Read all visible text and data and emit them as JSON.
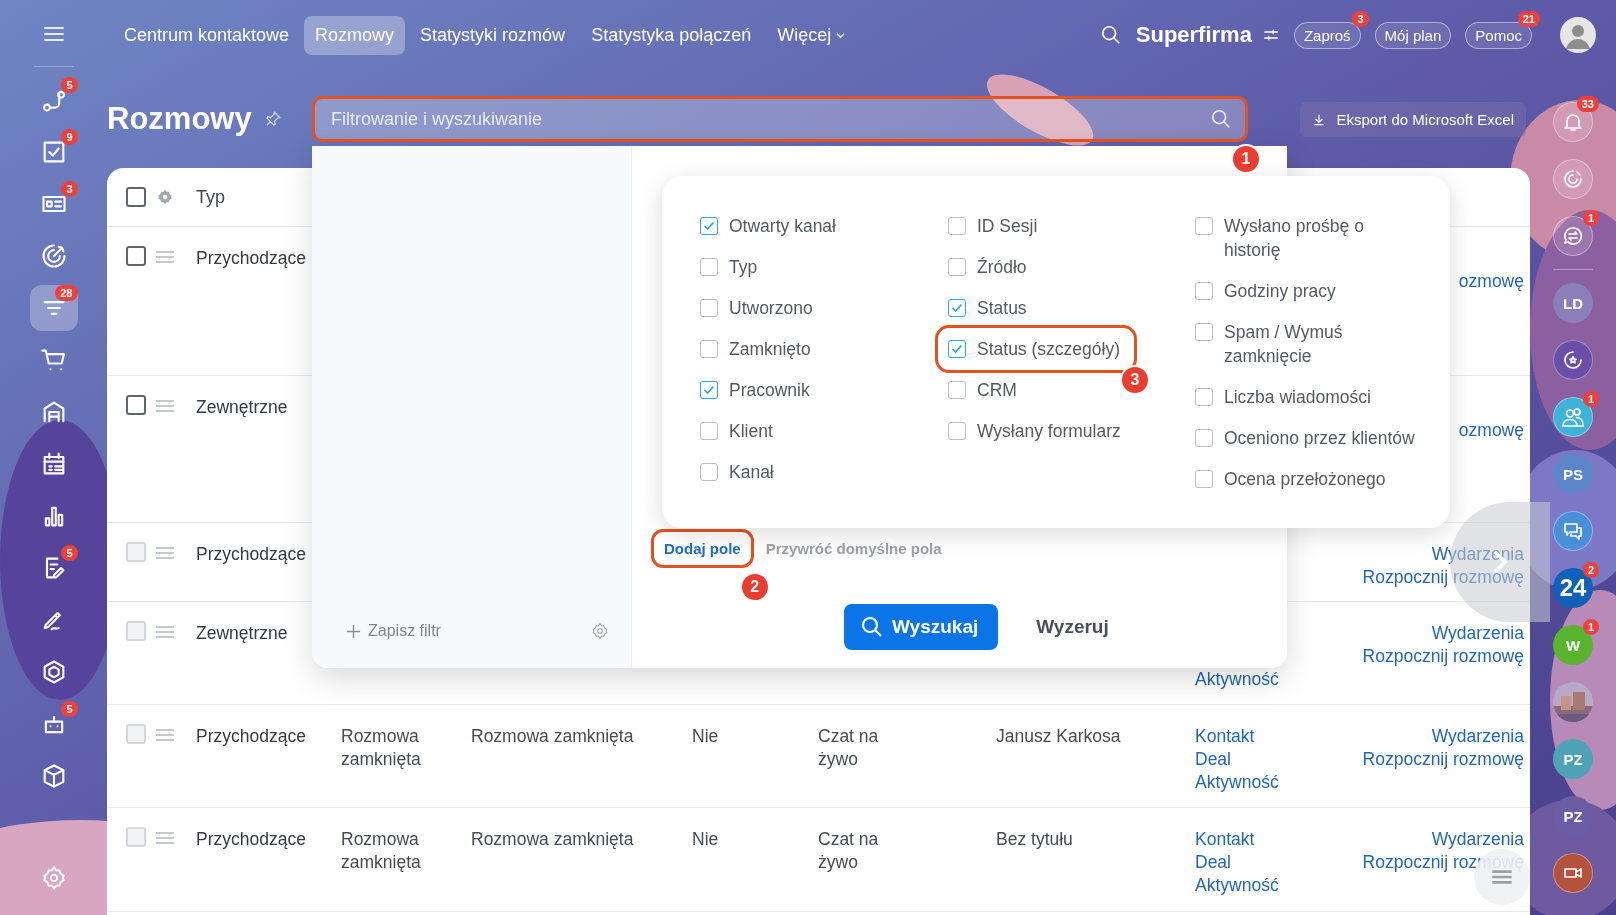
{
  "topbar": {
    "nav": [
      {
        "label": "Centrum kontaktowe",
        "selected": false
      },
      {
        "label": "Rozmowy",
        "selected": true
      },
      {
        "label": "Statystyki rozmów",
        "selected": false
      },
      {
        "label": "Statystyka połączeń",
        "selected": false
      }
    ],
    "more": "Więcej",
    "brand": "Superfirma",
    "buttons": [
      {
        "label": "Zaproś",
        "badge": "3"
      },
      {
        "label": "Mój plan"
      },
      {
        "label": "Pomoc",
        "badge": "21"
      }
    ]
  },
  "left_sidebar": {
    "items": [
      {
        "kind": "flow",
        "badge": "5",
        "selected": false
      },
      {
        "kind": "tasks",
        "badge": "9",
        "selected": false
      },
      {
        "kind": "contact",
        "badge": "3",
        "selected": false
      },
      {
        "kind": "target",
        "selected": false
      },
      {
        "kind": "funnel",
        "badge": "28",
        "selected": true
      },
      {
        "kind": "cart",
        "selected": false
      },
      {
        "kind": "warehouse",
        "selected": false
      },
      {
        "kind": "calendar",
        "selected": false
      },
      {
        "kind": "chart",
        "selected": false
      },
      {
        "kind": "document",
        "badge": "5",
        "selected": false
      },
      {
        "kind": "signature",
        "selected": false
      },
      {
        "kind": "hexagon",
        "selected": false
      },
      {
        "kind": "robot",
        "badge": "5",
        "selected": false
      },
      {
        "kind": "box",
        "selected": false
      }
    ]
  },
  "page": {
    "title": "Rozmowy",
    "search": {
      "placeholder": "Filtrowanie i wyszukiwanie",
      "callout": "1"
    },
    "export": "Eksport do Microsoft Excel"
  },
  "table": {
    "header": {
      "checked": false,
      "column_1": "Typ"
    },
    "rows": [
      {
        "checked": false,
        "disabled": false,
        "cells": {
          "column_1": "Przychodzące",
          "column_8": "ozmowę"
        }
      },
      {
        "checked": false,
        "disabled": false,
        "cells": {
          "column_1": "Zewnętrzne",
          "column_8": "ozmowę"
        }
      },
      {
        "checked": false,
        "disabled": true,
        "cells": {
          "column_1": "Przychodzące",
          "column_8": [
            "Wydarzenia",
            "Rozpocznij rozmowę"
          ]
        }
      },
      {
        "checked": false,
        "disabled": true,
        "cells": {
          "column_1": "Zewnętrzne",
          "column_7": "Aktywność",
          "column_8": [
            "Wydarzenia",
            "Rozpocznij rozmowę"
          ]
        }
      },
      {
        "checked": false,
        "disabled": true,
        "cells": {
          "column_1": "Przychodzące",
          "column_2": "Rozmowa zamknięta",
          "column_3": "Rozmowa zamknięta",
          "column_4": "Nie",
          "column_5": "Czat na żywo",
          "column_6": "Janusz Karkosa",
          "column_7": [
            "Kontakt",
            "Deal",
            "Aktywność"
          ],
          "column_8": [
            "Wydarzenia",
            "Rozpocznij rozmowę"
          ]
        }
      },
      {
        "checked": false,
        "disabled": true,
        "cells": {
          "column_1": "Przychodzące",
          "column_2": "Rozmowa zamknięta",
          "column_3": "Rozmowa zamknięta",
          "column_4": "Nie",
          "column_5": "Czat na żywo",
          "column_6": "Bez tytułu",
          "column_7": [
            "Kontakt",
            "Deal",
            "Aktywność"
          ],
          "column_8": [
            "Wydarzenia",
            "Rozpocznij rozmowę"
          ]
        }
      }
    ]
  },
  "filter_popup": {
    "save_filter": "Zapisz filtr",
    "fields": [
      [
        {
          "label": "Otwarty kanał",
          "checked": true
        },
        {
          "label": "Typ",
          "checked": false
        },
        {
          "label": "Utworzono",
          "checked": false
        },
        {
          "label": "Zamknięto",
          "checked": false
        },
        {
          "label": "Pracownik",
          "checked": true
        },
        {
          "label": "Klient",
          "checked": false
        },
        {
          "label": "Kanał",
          "checked": false
        }
      ],
      [
        {
          "label": "ID Sesji",
          "checked": false
        },
        {
          "label": "Źródło",
          "checked": false
        },
        {
          "label": "Status",
          "checked": true
        },
        {
          "label": "Status (szczegóły)",
          "checked": true,
          "callout": "3"
        },
        {
          "label": "CRM",
          "checked": false
        },
        {
          "label": "Wysłany formularz",
          "checked": false
        }
      ],
      [
        {
          "label": "Wysłano prośbę o historię",
          "checked": false
        },
        {
          "label": "Godziny pracy",
          "checked": false
        },
        {
          "label": "Spam / Wymuś zamknięcie",
          "checked": false
        },
        {
          "label": "Liczba wiadomości",
          "checked": false
        },
        {
          "label": "Oceniono przez klientów",
          "checked": false
        },
        {
          "label": "Ocena przełożonego",
          "checked": false
        }
      ]
    ],
    "add_field": {
      "label": "Dodaj pole",
      "callout": "2"
    },
    "restore": "Przywróć domyślne pola",
    "search_button": "Wyszukaj",
    "reset_button": "Wyzeruj"
  },
  "right_sidebar": {
    "items": [
      {
        "kind": "bell",
        "badge": "33"
      },
      {
        "kind": "ring"
      },
      {
        "kind": "chat-swap",
        "badge": "1"
      },
      {
        "kind": "avatar",
        "label": "LD",
        "color": "#8a7fb8"
      },
      {
        "kind": "ring-star",
        "color": "#6a4fa8"
      },
      {
        "kind": "group",
        "badge": "1",
        "color": "#3fb2d8"
      },
      {
        "kind": "avatar",
        "label": "PS",
        "color": "#5d86c9"
      },
      {
        "kind": "chat-bubbles",
        "color": "#4a90d9"
      },
      {
        "kind": "logo",
        "label": "24",
        "badge": "2",
        "color": "#0f62b8"
      },
      {
        "kind": "avatar",
        "label": "W",
        "badge": "1",
        "color": "#5ab52e"
      },
      {
        "kind": "picture"
      },
      {
        "kind": "avatar",
        "label": "PZ",
        "color": "#4fa3b5"
      },
      {
        "kind": "avatar",
        "label": "PZ",
        "color": "#6b5ca6"
      },
      {
        "kind": "video",
        "color": "#b5523e"
      }
    ]
  }
}
